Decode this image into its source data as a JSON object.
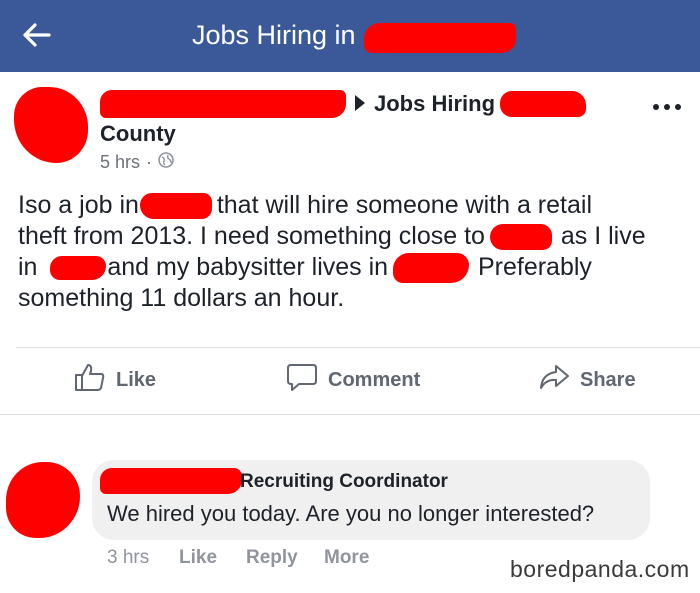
{
  "header": {
    "title": "Jobs Hiring in",
    "back_icon": "back-arrow-icon",
    "background": "#3b5998"
  },
  "post": {
    "group_name": "Jobs Hiring",
    "group_line2": "County",
    "time": "5 hrs",
    "visibility_icon": "globe-icon",
    "menu_icon": "more-options-icon",
    "body": {
      "l1_a": "Iso a job in",
      "l1_b": "that will hire someone with a retail",
      "l2_a": "theft from 2013. I need something close to",
      "l2_b": "as I live",
      "l3_a": "in",
      "l3_b": "and my babysitter lives in",
      "l3_c": "Preferably",
      "l4": "something 11 dollars an hour."
    },
    "actions": {
      "like": "Like",
      "comment": "Comment",
      "share": "Share"
    }
  },
  "comment": {
    "author_suffix": "Recruiting Coordinator",
    "text": "We hired you today. Are you no longer interested?",
    "time": "3 hrs",
    "like": "Like",
    "reply": "Reply",
    "more": "More"
  },
  "watermark": "boredpanda.com",
  "colors": {
    "redaction": "#ff0000",
    "muted_text": "#606770",
    "bubble": "#f1f0f0"
  }
}
